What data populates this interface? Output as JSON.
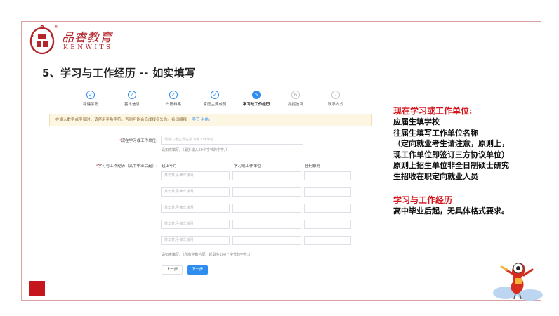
{
  "logo": {
    "cn": "品睿教育",
    "en": "KENWITS",
    "reg": "®"
  },
  "slide_title": "5、学习与工作经历 -- 如实填写",
  "steps": [
    {
      "label": "稳健学历",
      "state": "done",
      "mark": "✓"
    },
    {
      "label": "基本信息",
      "state": "done",
      "mark": "✓"
    },
    {
      "label": "户籍档案",
      "state": "done",
      "mark": "✓"
    },
    {
      "label": "家庭主要成员",
      "state": "done",
      "mark": "✓"
    },
    {
      "label": "学习与工作经历",
      "state": "active",
      "mark": "5"
    },
    {
      "label": "提招信况",
      "state": "todo",
      "mark": "6"
    },
    {
      "label": "联系方式",
      "state": "todo",
      "mark": "7"
    }
  ],
  "notice": {
    "text": "在输入数字或字母时，请使用半角字符。否则可能会造成报名失败。名词解释：",
    "link": "字节 半角。"
  },
  "current": {
    "label_req": "*",
    "label": "现在学习或工作单位:",
    "placeholder": "请输入考生现在学习或工作单位",
    "hint": "请如实填写。（最多输入60个字节的字符。）"
  },
  "history": {
    "label_req": "*",
    "label": "学习与工作经历（高中毕业后起）:",
    "columns": [
      "起止年月",
      "学习或工作单位",
      "任何职务"
    ],
    "period_placeholder": "某年某月-某年某月",
    "rows": 5,
    "hint": "请如实填写。（所有字数合同一起最多200个字节的字符。）"
  },
  "buttons": {
    "prev": "上一步",
    "next": "下一步"
  },
  "notes": {
    "head1": "现在学习或工作单位:",
    "lines1": [
      "应届生填学校",
      "往届生填写工作单位名称",
      "（定向就业考生请注意，原则上，",
      "现工作单位即签订三方协议单位）",
      "原则上招生单位非全日制硕士研究",
      "生招收在职定向就业人员"
    ],
    "head2": "学习与工作经历",
    "lines2": [
      "高中毕业后起，无具体格式要求。"
    ]
  },
  "colors": {
    "accent": "#2f8df0",
    "brand": "#b3262b",
    "note_red": "#d4141c"
  }
}
